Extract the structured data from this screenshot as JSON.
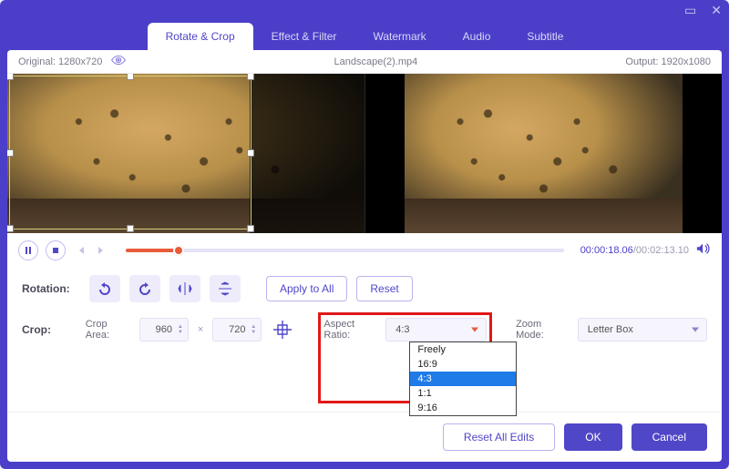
{
  "titlebar": {
    "min": "▭",
    "close": "✕"
  },
  "tabs": {
    "items": [
      {
        "label": "Rotate & Crop",
        "active": true
      },
      {
        "label": "Effect & Filter"
      },
      {
        "label": "Watermark"
      },
      {
        "label": "Audio"
      },
      {
        "label": "Subtitle"
      }
    ]
  },
  "info": {
    "original": "Original: 1280x720",
    "filename": "Landscape(2).mp4",
    "output": "Output: 1920x1080"
  },
  "playback": {
    "current": "00:00:18.06",
    "sep": "/",
    "total": "00:02:13.10"
  },
  "rotation": {
    "label": "Rotation:",
    "apply_all": "Apply to All",
    "reset": "Reset"
  },
  "crop": {
    "label": "Crop:",
    "area_label": "Crop Area:",
    "width": "960",
    "height": "720",
    "aspect_label": "Aspect Ratio:",
    "aspect_value": "4:3",
    "aspect_options": [
      "Freely",
      "16:9",
      "4:3",
      "1:1",
      "9:16"
    ],
    "zoom_label": "Zoom Mode:",
    "zoom_value": "Letter Box"
  },
  "footer": {
    "reset_all": "Reset All Edits",
    "ok": "OK",
    "cancel": "Cancel"
  },
  "colors": {
    "accent": "#5046c8",
    "orange": "#e85b3a",
    "red": "#e01818",
    "select_blue": "#1e7be8"
  }
}
